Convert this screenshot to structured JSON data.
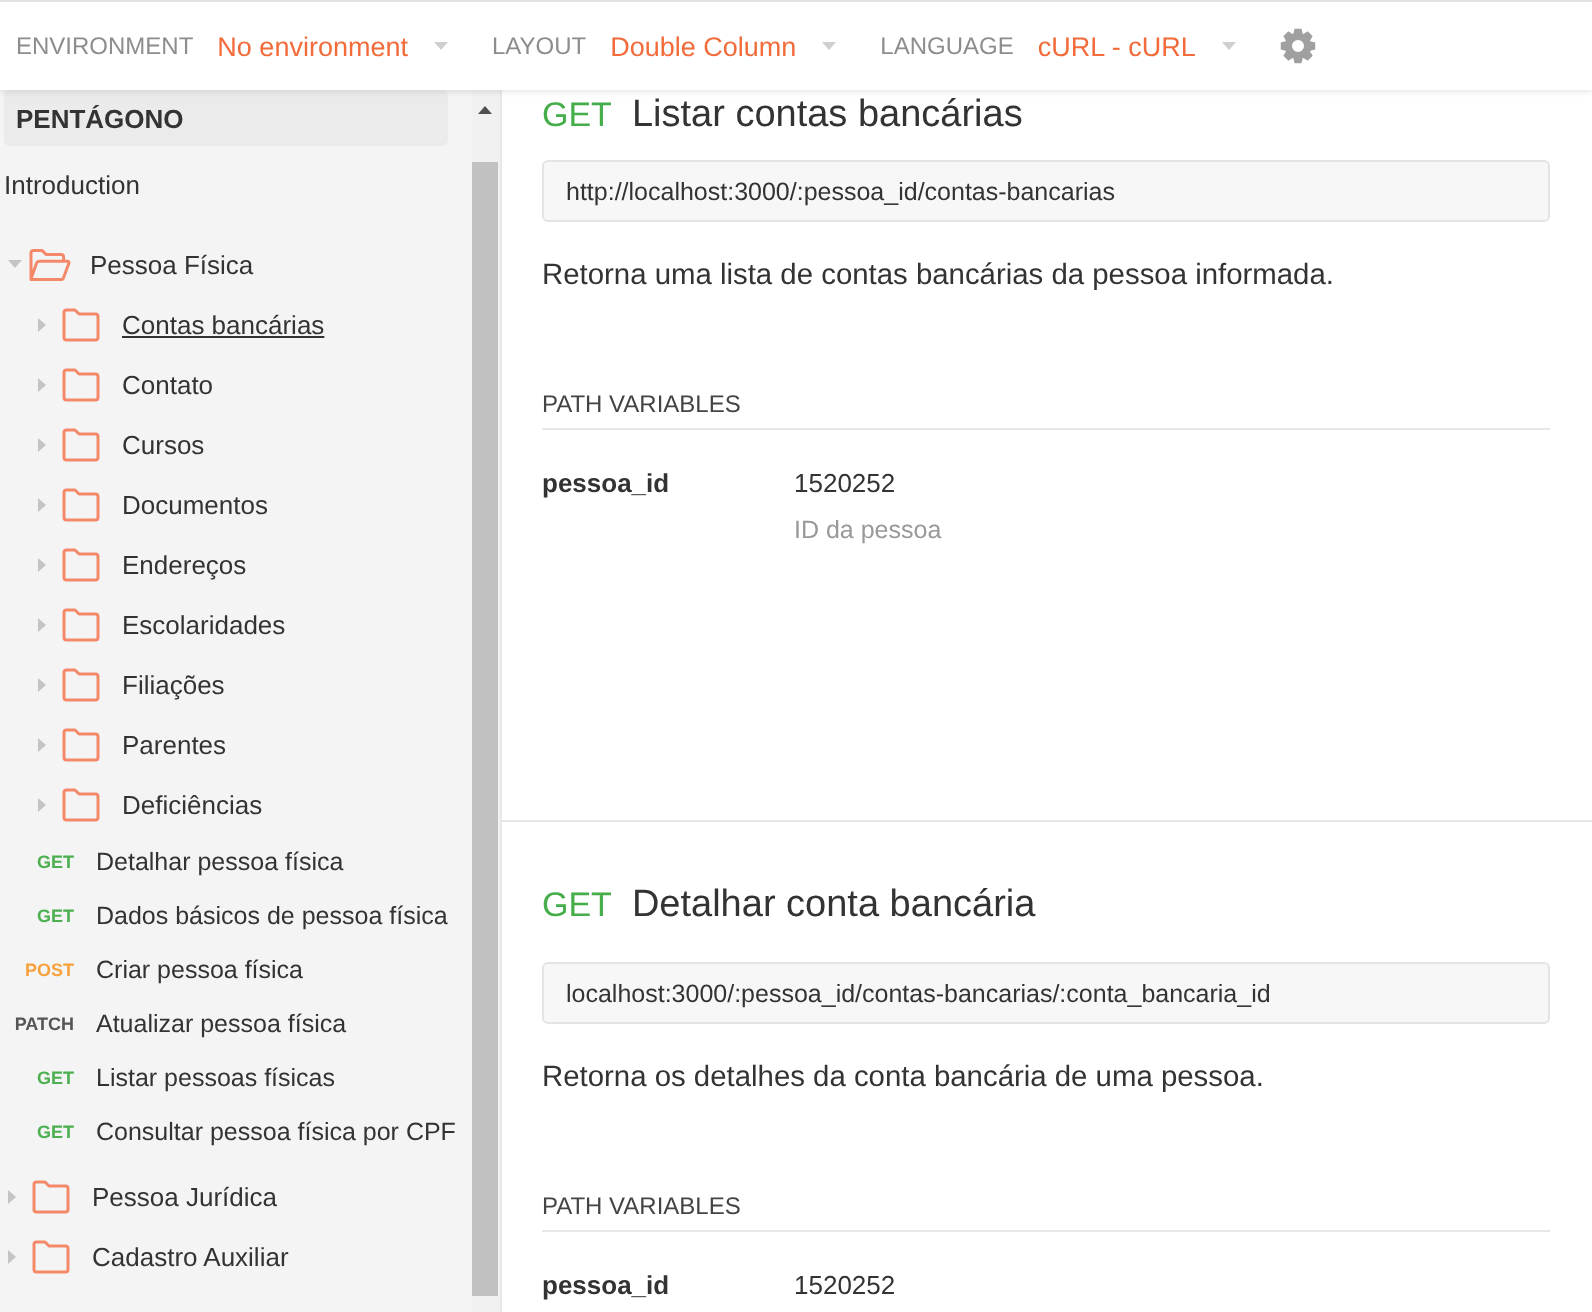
{
  "top_bar": {
    "settings": [
      {
        "label": "ENVIRONMENT",
        "value": "No environment"
      },
      {
        "label": "LAYOUT",
        "value": "Double Column"
      },
      {
        "label": "LANGUAGE",
        "value": "cURL - cURL"
      }
    ]
  },
  "sidebar": {
    "title": "PENTÁGONO",
    "items": [
      {
        "kind": "page",
        "label": "Introduction",
        "selected": false
      },
      {
        "kind": "folder",
        "label": "Pessoa Física",
        "expanded": true,
        "selected": false,
        "children": [
          {
            "kind": "folder",
            "label": "Contas bancárias",
            "expanded": false,
            "selected": true
          },
          {
            "kind": "folder",
            "label": "Contato",
            "expanded": false,
            "selected": false
          },
          {
            "kind": "folder",
            "label": "Cursos",
            "expanded": false,
            "selected": false
          },
          {
            "kind": "folder",
            "label": "Documentos",
            "expanded": false,
            "selected": false
          },
          {
            "kind": "folder",
            "label": "Endereços",
            "expanded": false,
            "selected": false
          },
          {
            "kind": "folder",
            "label": "Escolaridades",
            "expanded": false,
            "selected": false
          },
          {
            "kind": "folder",
            "label": "Filiações",
            "expanded": false,
            "selected": false
          },
          {
            "kind": "folder",
            "label": "Parentes",
            "expanded": false,
            "selected": false
          },
          {
            "kind": "folder",
            "label": "Deficiências",
            "expanded": false,
            "selected": false
          },
          {
            "kind": "request",
            "method": "GET",
            "color": "#4caf50",
            "label": "Detalhar pessoa física",
            "selected": false
          },
          {
            "kind": "request",
            "method": "GET",
            "color": "#4caf50",
            "label": "Dados básicos de pessoa física",
            "selected": false
          },
          {
            "kind": "request",
            "method": "POST",
            "color": "#f7a23e",
            "label": "Criar pessoa física",
            "selected": false
          },
          {
            "kind": "request",
            "method": "PATCH",
            "color": "#555555",
            "label": "Atualizar pessoa física",
            "selected": false
          },
          {
            "kind": "request",
            "method": "GET",
            "color": "#4caf50",
            "label": "Listar pessoas físicas",
            "selected": false
          },
          {
            "kind": "request",
            "method": "GET",
            "color": "#4caf50",
            "label": "Consultar pessoa física por CPF",
            "selected": false
          }
        ]
      },
      {
        "kind": "folder",
        "label": "Pessoa Jurídica",
        "expanded": false,
        "selected": false
      },
      {
        "kind": "folder",
        "label": "Cadastro Auxiliar",
        "expanded": false,
        "selected": false
      }
    ]
  },
  "sections": [
    {
      "method": "GET",
      "title": "Listar contas bancárias",
      "url": "http://localhost:3000/:pessoa_id/contas-bancarias",
      "description": "Retorna uma lista de contas bancárias da pessoa informada.",
      "path_variables": {
        "heading": "PATH VARIABLES",
        "rows": [
          {
            "name": "pessoa_id",
            "value": "1520252",
            "description": "ID da pessoa"
          }
        ]
      }
    },
    {
      "method": "GET",
      "title": "Detalhar conta bancária",
      "url": "localhost:3000/:pessoa_id/contas-bancarias/:conta_bancaria_id",
      "description": "Retorna os detalhes da conta bancária de uma pessoa.",
      "path_variables": {
        "heading": "PATH VARIABLES",
        "rows": [
          {
            "name": "pessoa_id",
            "value": "1520252"
          }
        ]
      }
    }
  ]
}
